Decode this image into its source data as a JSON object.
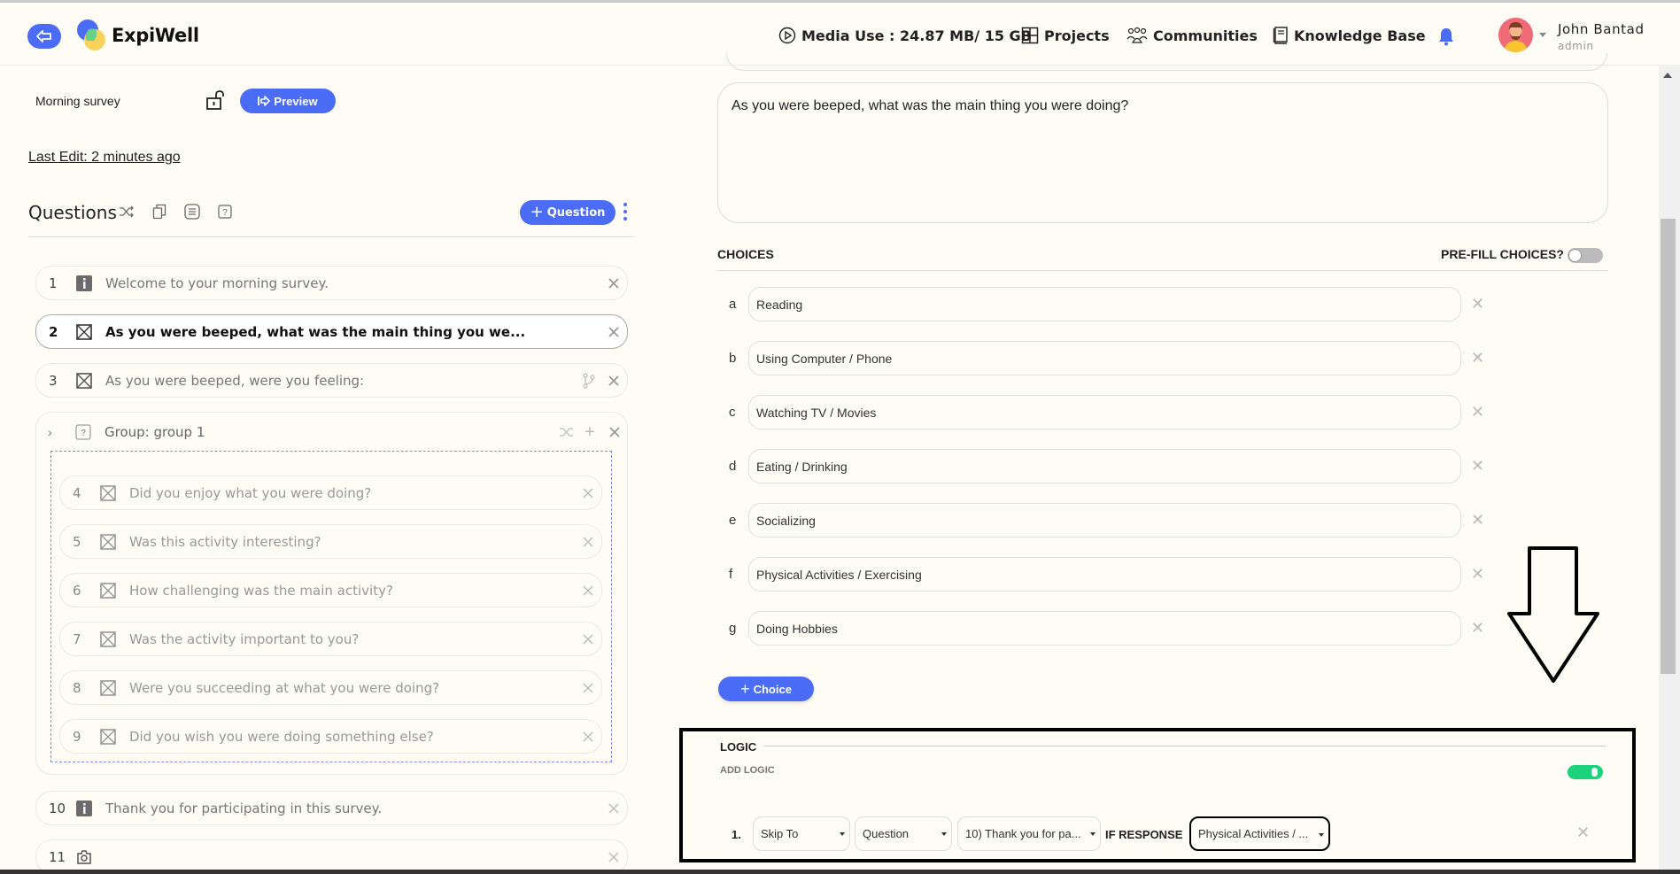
{
  "header": {
    "brand": "ExpiWell",
    "media_use": "Media Use : 24.87 MB/ 15 GB",
    "nav": [
      "Projects",
      "Communities",
      "Knowledge Base"
    ],
    "user_name": "John Bantad",
    "user_role": "admin",
    "accent": "#4a6cf7"
  },
  "survey": {
    "name": "Morning survey",
    "preview_label": "Preview",
    "last_edit": "Last Edit: 2 minutes ago"
  },
  "questions_panel": {
    "title": "Questions",
    "add_question_label": "Question",
    "items": [
      {
        "num": "1",
        "type": "info-icon",
        "text": "Welcome to your morning survey."
      },
      {
        "num": "2",
        "type": "multiple-choice-icon",
        "text": "As you were beeped, what was the main thing you we...",
        "active": true
      },
      {
        "num": "3",
        "type": "multiple-choice-icon",
        "text": "As you were beeped, were you feeling:"
      }
    ],
    "group": {
      "label": "Group: group 1",
      "items": [
        {
          "num": "4",
          "text": "Did you enjoy what you were doing?"
        },
        {
          "num": "5",
          "text": "Was this activity interesting?"
        },
        {
          "num": "6",
          "text": "How challenging was the main activity?"
        },
        {
          "num": "7",
          "text": "Was the activity important to you?"
        },
        {
          "num": "8",
          "text": "Were you succeeding at what you were doing?"
        },
        {
          "num": "9",
          "text": "Did you wish you were doing something else?"
        }
      ]
    },
    "after_group": [
      {
        "num": "10",
        "type": "info-icon",
        "text": "Thank you for participating in this survey."
      },
      {
        "num": "11",
        "type": "camera-icon",
        "text": ""
      }
    ]
  },
  "editor": {
    "question_text": "As you were beeped, what was the main thing you were doing?",
    "choices_label": "CHOICES",
    "prefill_label": "PRE-FILL CHOICES?",
    "prefill_enabled": false,
    "choices": [
      {
        "letter": "a",
        "value": "Reading"
      },
      {
        "letter": "b",
        "value": "Using Computer / Phone"
      },
      {
        "letter": "c",
        "value": "Watching TV / Movies"
      },
      {
        "letter": "d",
        "value": "Eating / Drinking"
      },
      {
        "letter": "e",
        "value": "Socializing"
      },
      {
        "letter": "f",
        "value": "Physical Activities / Exercising"
      },
      {
        "letter": "g",
        "value": "Doing Hobbies"
      }
    ],
    "add_choice_label": "Choice"
  },
  "logic": {
    "title": "LOGIC",
    "add_logic_label": "ADD LOGIC",
    "enabled": true,
    "rules": [
      {
        "num": "1.",
        "action": "Skip To",
        "target_type": "Question",
        "target": "10) Thank you for pa...",
        "if_label": "IF RESPONSE",
        "response": "Physical Activities / ..."
      }
    ]
  }
}
